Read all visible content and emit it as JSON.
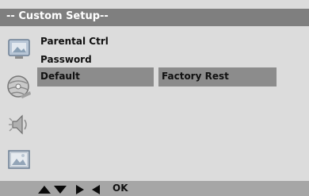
{
  "header": {
    "title": "-- Custom Setup--"
  },
  "sidebar": {
    "icons": [
      "tv-setup-icon",
      "disc-icon",
      "audio-speaker-icon",
      "picture-icon"
    ]
  },
  "menu": {
    "items": [
      {
        "label": "Parental Ctrl"
      },
      {
        "label": "Password"
      },
      {
        "label": "Default",
        "selected": true,
        "value": "Factory Rest"
      }
    ]
  },
  "footer": {
    "nav_icons": [
      "up-arrow-icon",
      "down-arrow-icon",
      "right-arrow-icon",
      "left-arrow-icon"
    ],
    "ok_label": "OK"
  }
}
